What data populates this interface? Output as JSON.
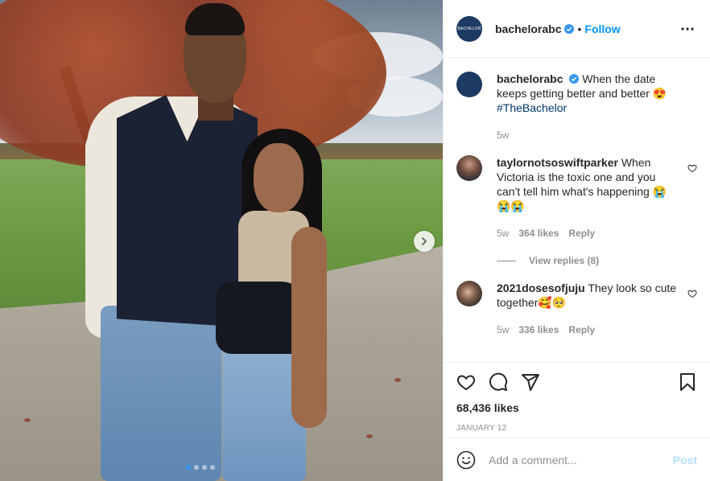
{
  "post": {
    "username": "bachelorabc",
    "avatar_text": "BACHELOR",
    "follow_label": "Follow",
    "separator": "•",
    "caption_text": "When the date keeps getting better and better 😍",
    "hashtag": "#TheBachelor",
    "caption_age": "5w",
    "likes": "68,436 likes",
    "date": "JANUARY 12",
    "carousel_slides": 4,
    "carousel_active": 1
  },
  "comments": [
    {
      "username": "taylornotsoswiftparker",
      "text": "When Victoria is the toxic one and you can't tell him what's happening 😭 😭😭",
      "age": "5w",
      "likes": "364 likes",
      "reply_label": "Reply",
      "view_replies": "View replies (8)"
    },
    {
      "username": "2021dosesofjuju",
      "text": "They look so cute together🥰🥺",
      "age": "5w",
      "likes": "336 likes",
      "reply_label": "Reply"
    }
  ],
  "add_comment": {
    "placeholder": "Add a comment...",
    "post_label": "Post"
  },
  "colors": {
    "link_blue": "#0095f6",
    "post_disabled": "#b2dffc",
    "muted": "#8e8e8e",
    "avatar_bg": "#1c3a62"
  },
  "icons": [
    "chevron-right-icon",
    "more-icon",
    "verified-icon",
    "heart-icon",
    "comment-icon",
    "share-icon",
    "bookmark-icon",
    "emoji-icon"
  ]
}
